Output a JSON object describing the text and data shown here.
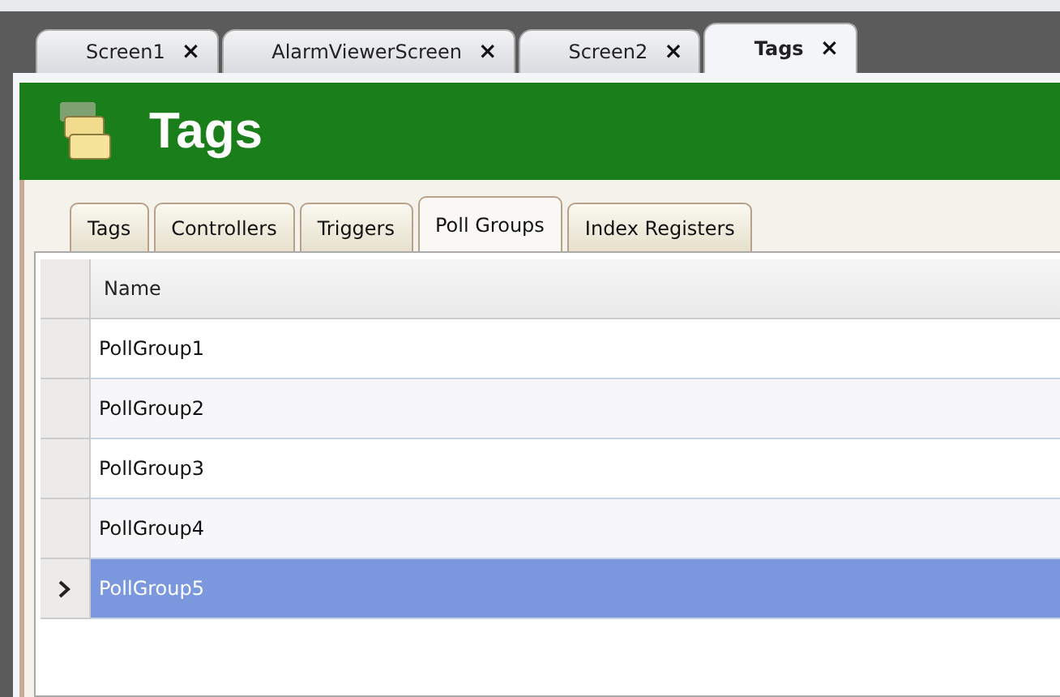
{
  "document_tabs": [
    {
      "label": "Screen1",
      "close": "×",
      "selected": false
    },
    {
      "label": "AlarmViewerScreen",
      "close": "×",
      "selected": false
    },
    {
      "label": "Screen2",
      "close": "×",
      "selected": false
    },
    {
      "label": "Tags",
      "close": "×",
      "selected": true
    }
  ],
  "header": {
    "title": "Tags"
  },
  "tabs": [
    {
      "label": "Tags",
      "selected": false
    },
    {
      "label": "Controllers",
      "selected": false
    },
    {
      "label": "Triggers",
      "selected": false
    },
    {
      "label": "Poll Groups",
      "selected": true
    },
    {
      "label": "Index Registers",
      "selected": false
    }
  ],
  "table": {
    "columns": [
      "Name"
    ],
    "rows": [
      {
        "name": "PollGroup1",
        "selected": false
      },
      {
        "name": "PollGroup2",
        "selected": false
      },
      {
        "name": "PollGroup3",
        "selected": false
      },
      {
        "name": "PollGroup4",
        "selected": false
      },
      {
        "name": "PollGroup5",
        "selected": true
      }
    ]
  }
}
